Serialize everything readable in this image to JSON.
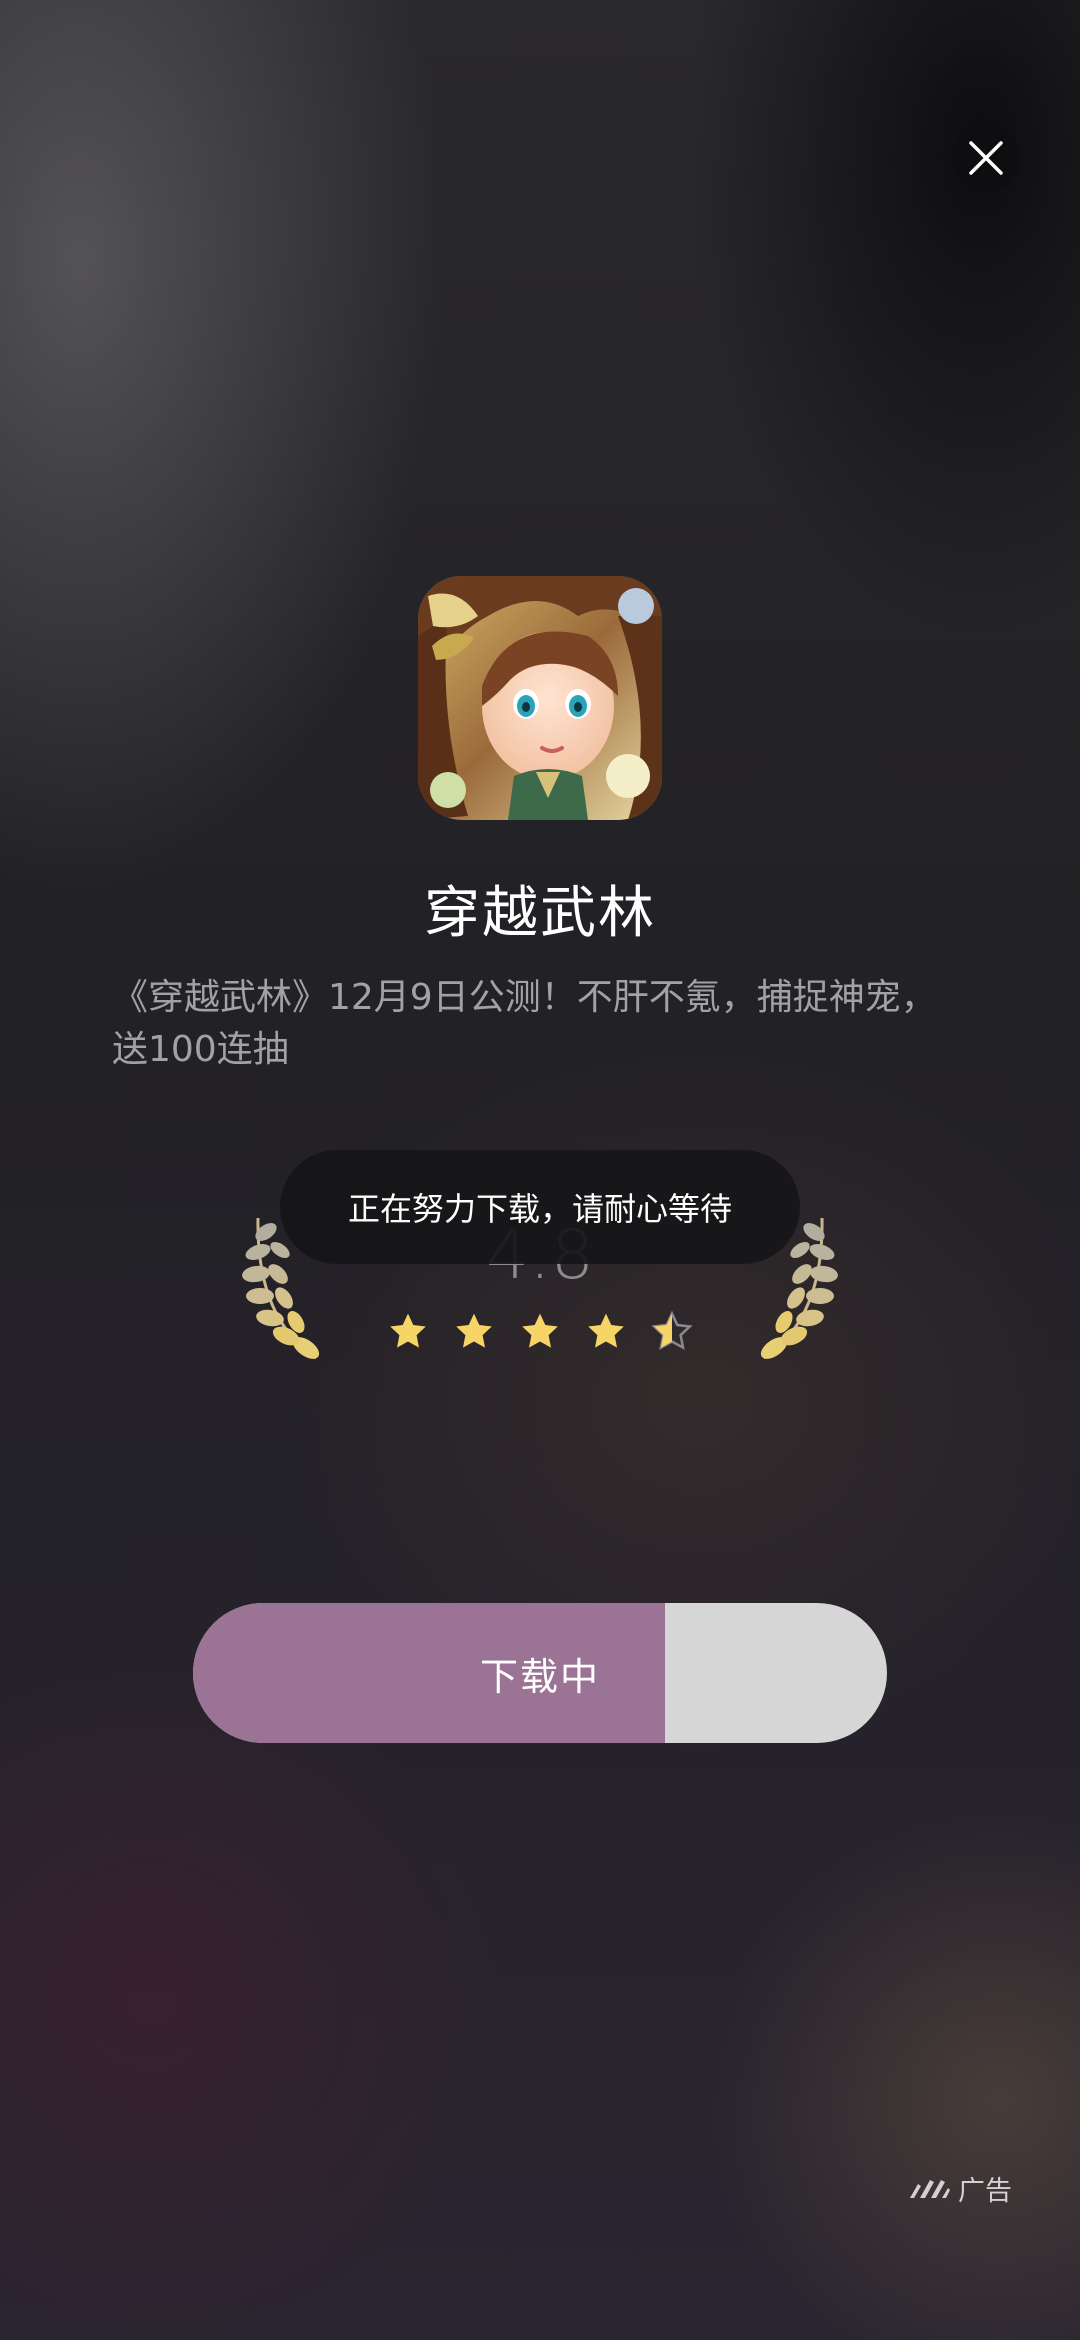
{
  "close_button": {
    "icon": "close-icon"
  },
  "app": {
    "name": "穿越武林",
    "description": "《穿越武林》12月9日公测！不肝不氪，捕捉神宠，送100连抽"
  },
  "rating": {
    "value": "4.8",
    "stars_filled_fraction": 0.96,
    "star_count": 5
  },
  "toast": {
    "text": "正在努力下载，请耐心等待"
  },
  "download_button": {
    "label": "下载中",
    "progress": 0.68,
    "fill_color": "#9b7395",
    "track_color": "#d6d6d6"
  },
  "ad_tag": {
    "label": "广告"
  }
}
